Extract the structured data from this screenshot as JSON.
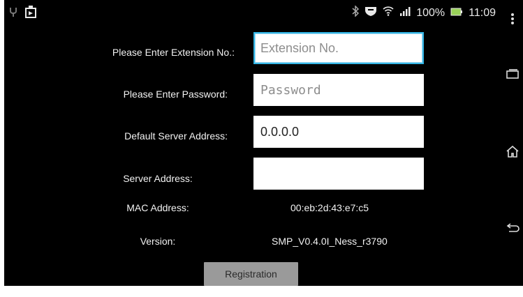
{
  "status_bar": {
    "battery_percent": "100%",
    "time": "11:09",
    "icons": [
      "usb-icon",
      "picture-icon",
      "bluetooth-icon",
      "shield-icon",
      "wifi-icon",
      "signal-icon",
      "battery-icon"
    ]
  },
  "form": {
    "extension": {
      "label": "Please Enter Extension No.:",
      "placeholder": "Extension No.",
      "value": ""
    },
    "password": {
      "label": "Please Enter Password:",
      "placeholder": "Password",
      "value": ""
    },
    "default_server": {
      "label": "Default Server Address:",
      "value": "0.0.0.0"
    },
    "server": {
      "label": "Server Address:",
      "value": ""
    },
    "mac": {
      "label": "MAC Address:",
      "value": "00:eb:2d:43:e7:c5"
    },
    "version": {
      "label": "Version:",
      "value": "SMP_V0.4.0I_Ness_r3790"
    }
  },
  "buttons": {
    "registration": "Registration"
  },
  "nav": {
    "icons": [
      "overflow-menu-icon",
      "recent-apps-icon",
      "home-icon",
      "back-icon"
    ]
  },
  "colors": {
    "background": "#000000",
    "focus": "#33b5e5",
    "button": "#9a9a9a"
  }
}
